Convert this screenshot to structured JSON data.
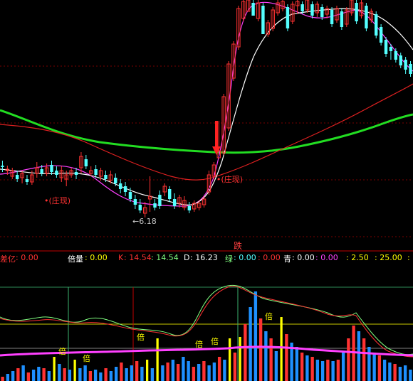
{
  "colors": {
    "background": "#000000",
    "up": "#ff3232",
    "down": "#54ffff",
    "ma_white": "#ffffff",
    "ma_magenta": "#ff40ff",
    "ma_red": "#dd2020",
    "ma_green": "#22dd22",
    "grid_red": "#7a0000",
    "yellow": "#ffff00",
    "blue": "#1e90ff",
    "lightgreen": "#80ff80"
  },
  "price_panel": {
    "low_marker": "6.18",
    "zhuangxian_label_1": "•(庄现)",
    "zhuangxian_label_2": "•(庄现)"
  },
  "separator_label": "跌",
  "indicator_row": {
    "chayi_label": "差亿",
    "chayi_value": ": 0.00",
    "beiliang_label": "倍量",
    "beiliang_value": ": 0.00",
    "k_label": "K",
    "k_value": ": 14.54",
    "v2": ": 14.54",
    "d_label": "D",
    "d_value": ": 16.23",
    "lv_label": "绿",
    "lv_value": ": 0.00",
    "lv_value2": ": 0.00",
    "qing_label": "青",
    "qing_value": ": 0.00",
    "qing_value2": ": 0.00",
    "v3": ": 2.50",
    "v4": ": 25.00",
    "v5": ":"
  },
  "bei_marks": [
    "倍",
    "倍",
    "倍",
    "倍",
    "倍",
    "倍"
  ],
  "chart_data": {
    "type": "candlestick",
    "price_low_label": 6.18,
    "ohlc": [
      [
        233,
        235,
        242,
        226
      ],
      [
        240,
        238,
        246,
        233
      ],
      [
        248,
        240,
        252,
        236
      ],
      [
        246,
        252,
        256,
        240
      ],
      [
        250,
        244,
        258,
        240
      ],
      [
        252,
        256,
        260,
        246
      ],
      [
        256,
        246,
        260,
        240
      ],
      [
        244,
        236,
        250,
        228
      ],
      [
        238,
        244,
        248,
        232
      ],
      [
        244,
        236,
        248,
        230
      ],
      [
        232,
        242,
        246,
        226
      ],
      [
        240,
        246,
        250,
        234
      ],
      [
        250,
        240,
        256,
        234
      ],
      [
        252,
        246,
        262,
        240
      ],
      [
        246,
        240,
        250,
        236
      ],
      [
        242,
        246,
        252,
        236
      ],
      [
        236,
        220,
        244,
        214
      ],
      [
        224,
        234,
        238,
        218
      ],
      [
        244,
        240,
        248,
        234
      ],
      [
        238,
        246,
        250,
        232
      ],
      [
        248,
        240,
        254,
        236
      ],
      [
        246,
        252,
        256,
        240
      ],
      [
        254,
        246,
        258,
        240
      ],
      [
        250,
        258,
        262,
        244
      ],
      [
        258,
        266,
        272,
        252
      ],
      [
        262,
        270,
        276,
        256
      ],
      [
        270,
        280,
        284,
        264
      ],
      [
        280,
        288,
        294,
        274
      ],
      [
        288,
        296,
        300,
        280
      ],
      [
        300,
        292,
        306,
        284
      ],
      [
        280,
        276,
        298,
        248
      ],
      [
        286,
        292,
        296,
        280
      ],
      [
        274,
        290,
        294,
        268
      ],
      [
        270,
        262,
        276,
        258
      ],
      [
        266,
        280,
        284,
        262
      ],
      [
        280,
        290,
        294,
        272
      ],
      [
        286,
        278,
        292,
        274
      ],
      [
        292,
        282,
        296,
        276
      ],
      [
        290,
        296,
        300,
        284
      ],
      [
        294,
        286,
        298,
        282
      ],
      [
        292,
        286,
        296,
        282
      ],
      [
        288,
        280,
        292,
        276
      ],
      [
        270,
        246,
        274,
        240
      ],
      [
        248,
        232,
        252,
        228
      ],
      [
        222,
        212,
        218,
        170
      ],
      [
        215,
        136,
        218,
        132
      ],
      [
        180,
        90,
        184,
        86
      ],
      [
        110,
        62,
        114,
        58
      ],
      [
        66,
        12,
        70,
        8
      ],
      [
        26,
        2,
        30,
        -5
      ],
      [
        12,
        -4,
        16,
        -8
      ],
      [
        4,
        22,
        8,
        -4
      ],
      [
        26,
        4,
        30,
        0
      ],
      [
        8,
        48,
        12,
        4
      ],
      [
        48,
        32,
        52,
        28
      ],
      [
        40,
        14,
        44,
        10
      ],
      [
        18,
        4,
        22,
        -2
      ],
      [
        12,
        2,
        16,
        -2
      ],
      [
        10,
        40,
        44,
        6
      ],
      [
        30,
        6,
        34,
        2
      ],
      [
        8,
        2,
        20,
        -2
      ],
      [
        6,
        16,
        20,
        2
      ],
      [
        14,
        0,
        18,
        -4
      ],
      [
        6,
        22,
        26,
        2
      ],
      [
        18,
        6,
        24,
        2
      ],
      [
        10,
        24,
        28,
        6
      ],
      [
        20,
        12,
        26,
        8
      ],
      [
        14,
        34,
        38,
        10
      ],
      [
        28,
        12,
        32,
        8
      ],
      [
        16,
        38,
        42,
        12
      ],
      [
        34,
        14,
        38,
        10
      ],
      [
        18,
        0,
        22,
        -4
      ],
      [
        4,
        30,
        34,
        0
      ],
      [
        22,
        4,
        26,
        0
      ],
      [
        8,
        40,
        44,
        4
      ],
      [
        28,
        16,
        32,
        12
      ],
      [
        20,
        50,
        54,
        16
      ],
      [
        38,
        60,
        64,
        34
      ],
      [
        56,
        76,
        80,
        52
      ],
      [
        66,
        72,
        84,
        62
      ],
      [
        72,
        84,
        88,
        68
      ],
      [
        78,
        92,
        96,
        74
      ],
      [
        84,
        98,
        104,
        80
      ],
      [
        90,
        104,
        108,
        86
      ]
    ],
    "volume_bars": [
      [
        6,
        "r"
      ],
      [
        10,
        "b"
      ],
      [
        14,
        "b"
      ],
      [
        18,
        "r"
      ],
      [
        22,
        "b"
      ],
      [
        12,
        "r"
      ],
      [
        16,
        "b"
      ],
      [
        20,
        "b"
      ],
      [
        18,
        "r"
      ],
      [
        14,
        "b"
      ],
      [
        34,
        "y"
      ],
      [
        24,
        "b"
      ],
      [
        18,
        "r"
      ],
      [
        16,
        "b"
      ],
      [
        30,
        "y"
      ],
      [
        18,
        "b"
      ],
      [
        22,
        "b"
      ],
      [
        14,
        "r"
      ],
      [
        16,
        "b"
      ],
      [
        12,
        "b"
      ],
      [
        18,
        "r"
      ],
      [
        14,
        "b"
      ],
      [
        20,
        "b"
      ],
      [
        26,
        "r"
      ],
      [
        18,
        "b"
      ],
      [
        22,
        "b"
      ],
      [
        28,
        "r"
      ],
      [
        20,
        "b"
      ],
      [
        30,
        "y"
      ],
      [
        18,
        "b"
      ],
      [
        60,
        "y"
      ],
      [
        22,
        "b"
      ],
      [
        26,
        "r"
      ],
      [
        30,
        "b"
      ],
      [
        24,
        "r"
      ],
      [
        34,
        "b"
      ],
      [
        28,
        "b"
      ],
      [
        20,
        "r"
      ],
      [
        24,
        "b"
      ],
      [
        28,
        "r"
      ],
      [
        22,
        "b"
      ],
      [
        26,
        "b"
      ],
      [
        34,
        "r"
      ],
      [
        30,
        "b"
      ],
      [
        60,
        "y"
      ],
      [
        40,
        "r"
      ],
      [
        62,
        "y"
      ],
      [
        80,
        "r"
      ],
      [
        104,
        "b"
      ],
      [
        126,
        "b"
      ],
      [
        88,
        "r"
      ],
      [
        70,
        "b"
      ],
      [
        60,
        "r"
      ],
      [
        42,
        "b"
      ],
      [
        90,
        "y"
      ],
      [
        66,
        "r"
      ],
      [
        54,
        "b"
      ],
      [
        48,
        "b"
      ],
      [
        40,
        "r"
      ],
      [
        36,
        "b"
      ],
      [
        34,
        "r"
      ],
      [
        30,
        "b"
      ],
      [
        28,
        "b"
      ],
      [
        30,
        "r"
      ],
      [
        28,
        "b"
      ],
      [
        30,
        "r"
      ],
      [
        40,
        "b"
      ],
      [
        60,
        "r"
      ],
      [
        78,
        "r"
      ],
      [
        70,
        "b"
      ],
      [
        60,
        "r"
      ],
      [
        48,
        "b"
      ],
      [
        40,
        "b"
      ],
      [
        36,
        "r"
      ],
      [
        30,
        "b"
      ],
      [
        26,
        "b"
      ],
      [
        24,
        "r"
      ],
      [
        20,
        "b"
      ],
      [
        22,
        "b"
      ],
      [
        16,
        "b"
      ]
    ]
  }
}
